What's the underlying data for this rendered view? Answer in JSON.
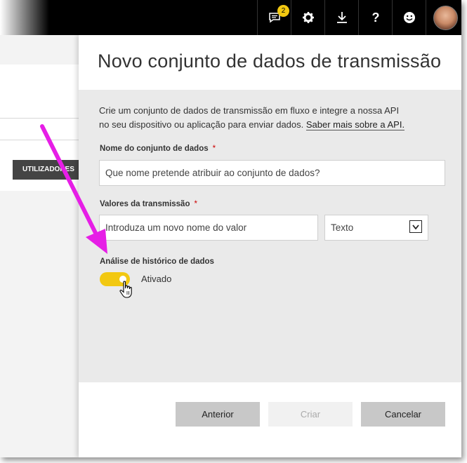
{
  "topbar": {
    "notifications_count": "2",
    "icons": [
      "notifications-icon",
      "gear-icon",
      "download-icon",
      "help-icon",
      "smiley-icon",
      "avatar"
    ]
  },
  "background": {
    "column_header": "UTILIZADORES"
  },
  "panel": {
    "title": "Novo conjunto de dados de transmissão",
    "description_line1": "Crie um conjunto de dados de transmissão em fluxo e integre a nossa API",
    "description_line2": "no seu dispositivo ou aplicação para enviar dados.",
    "learn_more_link": "Saber mais sobre a API.",
    "dataset_name": {
      "label": "Nome do conjunto de dados",
      "required": "*",
      "placeholder": "Que nome pretende atribuir ao conjunto de dados?"
    },
    "stream_values": {
      "label": "Valores da transmissão",
      "required": "*",
      "value_placeholder": "Introduza um novo nome do valor",
      "type_selected": "Texto"
    },
    "history_analysis": {
      "label": "Análise de histórico de dados",
      "toggle_state": "Ativado",
      "enabled": true
    },
    "buttons": {
      "previous": "Anterior",
      "create": "Criar",
      "cancel": "Cancelar"
    }
  },
  "colors": {
    "accent_yellow": "#f2c811",
    "annotation_arrow": "#e61ee6",
    "topbar": "#000000"
  }
}
